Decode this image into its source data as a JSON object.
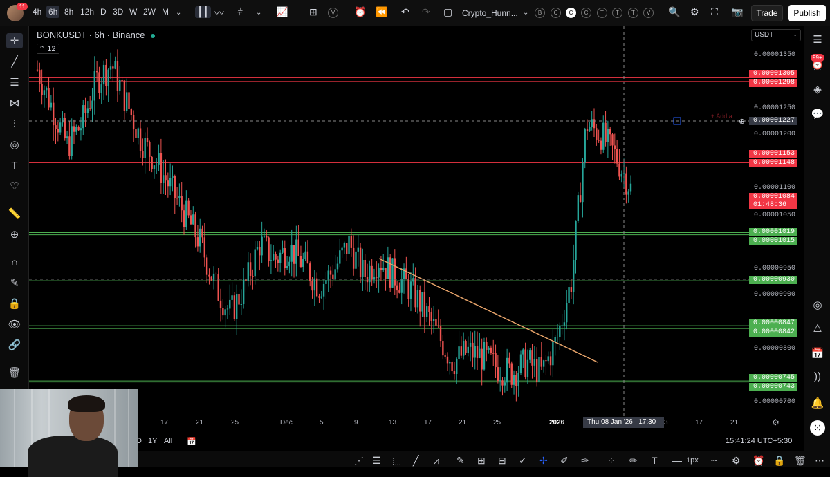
{
  "topbar": {
    "notification_count": "11",
    "timeframes": [
      "4h",
      "6h",
      "8h",
      "12h",
      "D",
      "3D",
      "W",
      "2W",
      "M"
    ],
    "active_timeframe": "6h",
    "layout_name": "Crypto_Hunn...",
    "shortcut_letters": [
      "B",
      "C",
      "C",
      "C",
      "T",
      "T",
      "T",
      "V"
    ],
    "trade_label": "Trade",
    "publish_label": "Publish",
    "interval_badge": "V"
  },
  "legend": {
    "symbol": "BONKUSDT · 6h · Binance",
    "count": "12"
  },
  "currency": "USDT",
  "price_axis": {
    "labels": [
      "0.00001350",
      "0.00001250",
      "0.00001200",
      "0.00001100",
      "0.00001050",
      "0.00000950",
      "0.00000900",
      "0.00000800",
      "0.00000700"
    ],
    "current_price": "0.00001084",
    "countdown": "01:48:36",
    "crosshair_price": "0.00001227",
    "levels": [
      {
        "id": "r1a",
        "price": "0.00001305",
        "color": "#f23645"
      },
      {
        "id": "r1b",
        "price": "0.00001298",
        "color": "#f23645"
      },
      {
        "id": "r2a",
        "price": "0.00001153",
        "color": "#f23645"
      },
      {
        "id": "r2b",
        "price": "0.00001148",
        "color": "#f23645"
      },
      {
        "id": "s1a",
        "price": "0.00001019",
        "color": "#4caf50"
      },
      {
        "id": "s1b",
        "price": "0.00001015",
        "color": "#4caf50"
      },
      {
        "id": "s2",
        "price": "0.00000930",
        "color": "#4caf50"
      },
      {
        "id": "s3a",
        "price": "0.00000847",
        "color": "#4caf50"
      },
      {
        "id": "s3b",
        "price": "0.00000842",
        "color": "#4caf50"
      },
      {
        "id": "s4a",
        "price": "0.00000745",
        "color": "#4caf50"
      },
      {
        "id": "s4b",
        "price": "0.00000743",
        "color": "#4caf50"
      }
    ]
  },
  "time_axis": {
    "labels": [
      "17",
      "21",
      "25",
      "Dec",
      "5",
      "9",
      "13",
      "17",
      "21",
      "25",
      "2026",
      "3",
      "17",
      "21"
    ],
    "crosshair_date": "Thu 08 Jan '26",
    "crosshair_time": "17:30"
  },
  "add_alert_text": "+ Add a",
  "right_badge": "99+",
  "bottom": {
    "ranges": [
      "D",
      "1Y",
      "All"
    ],
    "clock": "15:41:24 UTC+5:30",
    "lock_label": "1px"
  },
  "chart_data": {
    "type": "candlestick",
    "symbol": "BONKUSDT",
    "interval": "6h",
    "exchange": "Binance",
    "ylim": [
      6.8e-06,
      1.4e-05
    ],
    "close_path": [
      1.32e-05,
      1.25e-05,
      1.18e-05,
      1.22e-05,
      1.3e-05,
      1.33e-05,
      1.26e-05,
      1.19e-05,
      1.15e-05,
      1.1e-05,
      1.05e-05,
      1e-05,
      9.2e-06,
      8.7e-06,
      9.2e-06,
      1e-05,
      9.7e-06,
      9.9e-06,
      9.6e-06,
      9.2e-06,
      9.5e-06,
      1e-05,
      9.4e-06,
      9.7e-06,
      9.4e-06,
      9.2e-06,
      8.8e-06,
      8.3e-06,
      7.8e-06,
      8e-06,
      7.9e-06,
      7.7e-06,
      7.6e-06,
      7.8e-06,
      7.6e-06,
      8.2e-06,
      9.3e-06,
      1.22e-05,
      1.2e-05,
      1.16e-05,
      1.1e-05
    ],
    "trendline": {
      "from": [
        9.8e-06
      ],
      "to": [
        7.7e-06
      ]
    }
  }
}
